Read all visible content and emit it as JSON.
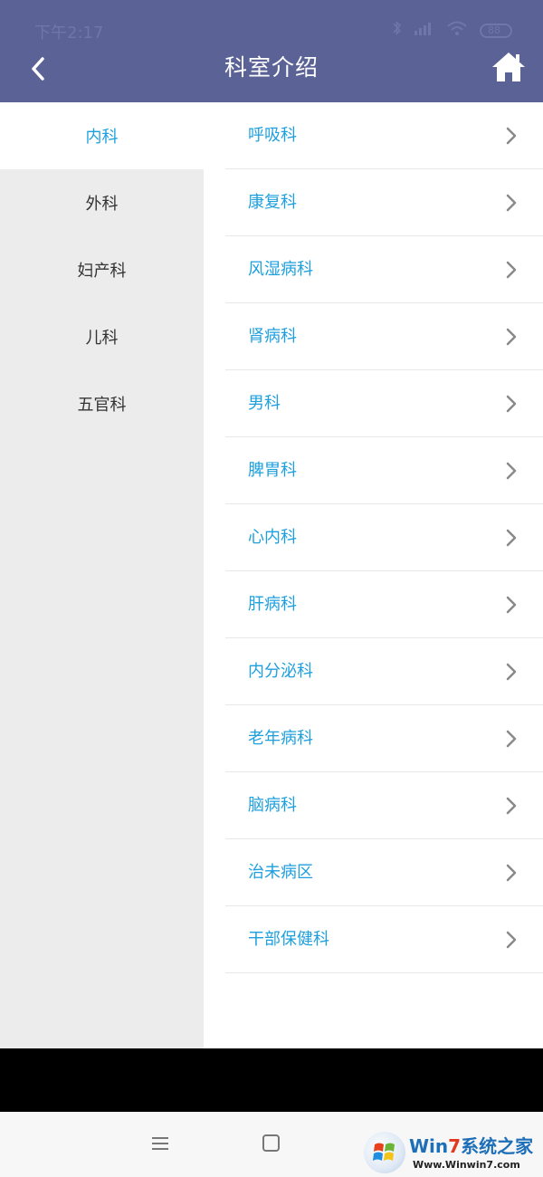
{
  "status_bar": {
    "time": "下午2:17",
    "battery": "88"
  },
  "header": {
    "title": "科室介绍",
    "back_icon": "chevron-left-icon",
    "home_icon": "home-icon"
  },
  "left_menu": {
    "items": [
      {
        "label": "内科",
        "active": true
      },
      {
        "label": "外科",
        "active": false
      },
      {
        "label": "妇产科",
        "active": false
      },
      {
        "label": "儿科",
        "active": false
      },
      {
        "label": "五官科",
        "active": false
      }
    ]
  },
  "right_list": {
    "items": [
      {
        "label": "呼吸科"
      },
      {
        "label": "康复科"
      },
      {
        "label": "风湿病科"
      },
      {
        "label": "肾病科"
      },
      {
        "label": "男科"
      },
      {
        "label": "脾胃科"
      },
      {
        "label": "心内科"
      },
      {
        "label": "肝病科"
      },
      {
        "label": "内分泌科"
      },
      {
        "label": "老年病科"
      },
      {
        "label": "脑病科"
      },
      {
        "label": "治未病区"
      },
      {
        "label": "干部保健科"
      }
    ]
  },
  "watermark": {
    "title_a": "Win",
    "title_b": "7",
    "title_c": "系统之家",
    "url": "Www.Winwin7.com"
  },
  "colors": {
    "header": "#5a6296",
    "accent": "#1fa0de",
    "left_bg": "#ececec"
  }
}
